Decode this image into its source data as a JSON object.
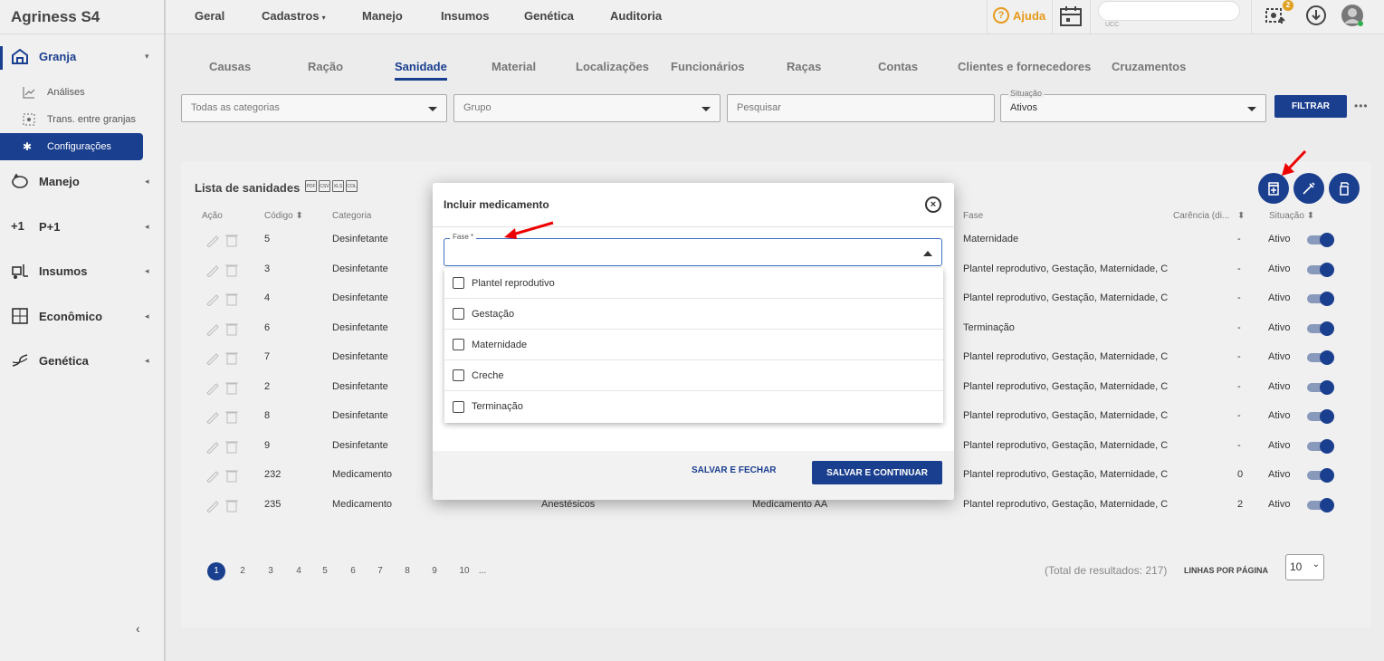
{
  "app": {
    "title": "Agriness S4"
  },
  "topnav": [
    "Geral",
    "Cadastros",
    "Manejo",
    "Insumos",
    "Genética",
    "Auditoria"
  ],
  "topbar": {
    "help": "Ajuda",
    "ucc": "UCC",
    "notif_count": "2"
  },
  "sidebar": {
    "granja": "Granja",
    "sub": [
      "Análises",
      "Trans. entre granjas",
      "Configurações"
    ],
    "items": [
      "Manejo",
      "P+1",
      "Insumos",
      "Econômico",
      "Genética"
    ],
    "p1_icon": "+1"
  },
  "subtabs": [
    "Causas",
    "Ração",
    "Sanidade",
    "Material",
    "Localizações",
    "Funcionários",
    "Raças",
    "Contas",
    "Clientes e fornecedores",
    "Cruzamentos"
  ],
  "filters": {
    "categoria": "Todas as categorias",
    "grupo": "Grupo",
    "pesquisar": "Pesquisar",
    "situacao_label": "Situação",
    "situacao_value": "Ativos",
    "filtrar": "FILTRAR"
  },
  "list": {
    "title": "Lista de sanidades",
    "export": [
      "PDF",
      "CSV",
      "XLS",
      "COL"
    ],
    "headers": [
      "Ação",
      "Código",
      "Categoria",
      "Fase",
      "Carência (di...",
      "Situação"
    ],
    "rows": [
      {
        "codigo": "5",
        "categoria": "Desinfetante",
        "grupo": "",
        "nome": "",
        "fase": "Maternidade",
        "carencia": "-",
        "situacao": "Ativo"
      },
      {
        "codigo": "3",
        "categoria": "Desinfetante",
        "grupo": "",
        "nome": "",
        "fase": "Plantel reprodutivo, Gestação, Maternidade, C",
        "carencia": "-",
        "situacao": "Ativo"
      },
      {
        "codigo": "4",
        "categoria": "Desinfetante",
        "grupo": "",
        "nome": "",
        "fase": "Plantel reprodutivo, Gestação, Maternidade, C",
        "carencia": "-",
        "situacao": "Ativo"
      },
      {
        "codigo": "6",
        "categoria": "Desinfetante",
        "grupo": "",
        "nome": "",
        "fase": "Terminação",
        "carencia": "-",
        "situacao": "Ativo"
      },
      {
        "codigo": "7",
        "categoria": "Desinfetante",
        "grupo": "",
        "nome": "",
        "fase": "Plantel reprodutivo, Gestação, Maternidade, C",
        "carencia": "-",
        "situacao": "Ativo"
      },
      {
        "codigo": "2",
        "categoria": "Desinfetante",
        "grupo": "",
        "nome": "",
        "fase": "Plantel reprodutivo, Gestação, Maternidade, C",
        "carencia": "-",
        "situacao": "Ativo"
      },
      {
        "codigo": "8",
        "categoria": "Desinfetante",
        "grupo": "",
        "nome": "",
        "fase": "Plantel reprodutivo, Gestação, Maternidade, C",
        "carencia": "-",
        "situacao": "Ativo"
      },
      {
        "codigo": "9",
        "categoria": "Desinfetante",
        "grupo": "",
        "nome": "",
        "fase": "Plantel reprodutivo, Gestação, Maternidade, C",
        "carencia": "-",
        "situacao": "Ativo"
      },
      {
        "codigo": "232",
        "categoria": "Medicamento",
        "grupo": "",
        "nome": "",
        "fase": "Plantel reprodutivo, Gestação, Maternidade, C",
        "carencia": "0",
        "situacao": "Ativo"
      },
      {
        "codigo": "235",
        "categoria": "Medicamento",
        "grupo": "Anestésicos",
        "nome": "Medicamento AA",
        "fase": "Plantel reprodutivo, Gestação, Maternidade, C",
        "carencia": "2",
        "situacao": "Ativo"
      }
    ]
  },
  "pagination": {
    "pages": [
      "1",
      "2",
      "3",
      "4",
      "5",
      "6",
      "7",
      "8",
      "9",
      "10",
      "..."
    ],
    "total": "(Total de resultados: 217)",
    "linhas_label": "LINHAS POR PÁGINA",
    "linhas_value": "10"
  },
  "modal": {
    "title": "Incluir medicamento",
    "fase_label": "Fase *",
    "options": [
      "Plantel reprodutivo",
      "Gestação",
      "Maternidade",
      "Creche",
      "Terminação"
    ],
    "btn_salvar_fechar": "SALVAR E FECHAR",
    "btn_salvar_continuar": "SALVAR E CONTINUAR"
  }
}
